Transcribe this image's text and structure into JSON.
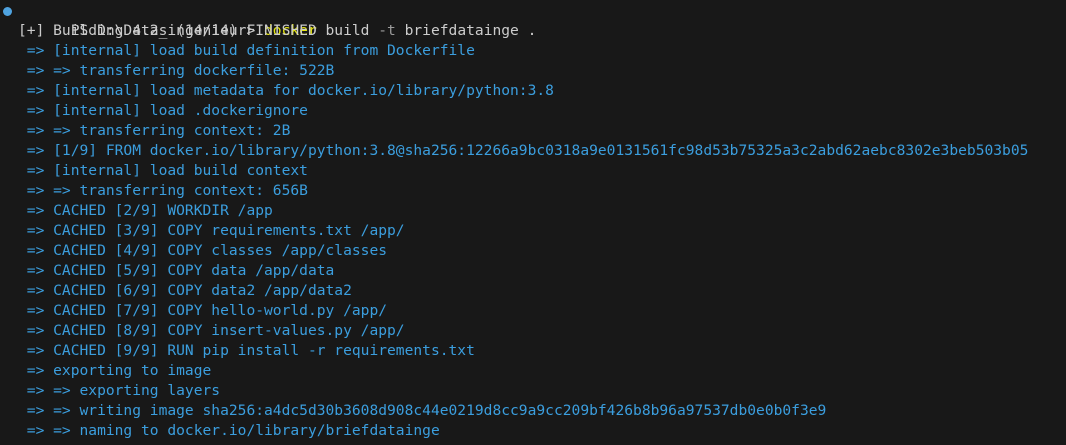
{
  "prompt": {
    "prefix": "PS D:\\Data_ingenieur> ",
    "command": "docker",
    "args1": " build ",
    "flag": "-t",
    "args2": " briefdatainge ."
  },
  "output": {
    "status": "[+] Building 4.2s (14/14) FINISHED",
    "steps": [
      " => [internal] load build definition from Dockerfile",
      " => => transferring dockerfile: 522B",
      " => [internal] load metadata for docker.io/library/python:3.8",
      " => [internal] load .dockerignore",
      " => => transferring context: 2B",
      " => [1/9] FROM docker.io/library/python:3.8@sha256:12266a9bc0318a9e0131561fc98d53b75325a3c2abd62aebc8302e3beb503b05",
      " => [internal] load build context",
      " => => transferring context: 656B",
      " => CACHED [2/9] WORKDIR /app",
      " => CACHED [3/9] COPY requirements.txt /app/",
      " => CACHED [4/9] COPY classes /app/classes",
      " => CACHED [5/9] COPY data /app/data",
      " => CACHED [6/9] COPY data2 /app/data2",
      " => CACHED [7/9] COPY hello-world.py /app/",
      " => CACHED [8/9] COPY insert-values.py /app/",
      " => CACHED [9/9] RUN pip install -r requirements.txt",
      " => exporting to image",
      " => => exporting layers",
      " => => writing image sha256:a4dc5d30b3608d908c44e0219d8cc9a9cc209bf426b8b96a97537db0e0b0f3e9",
      " => => naming to docker.io/library/briefdatainge"
    ]
  },
  "colors": {
    "background": "#181818",
    "text": "#cccccc",
    "command": "#e5e510",
    "step_text": "#3b9ede",
    "prompt_dot": "#4fa3e0"
  }
}
